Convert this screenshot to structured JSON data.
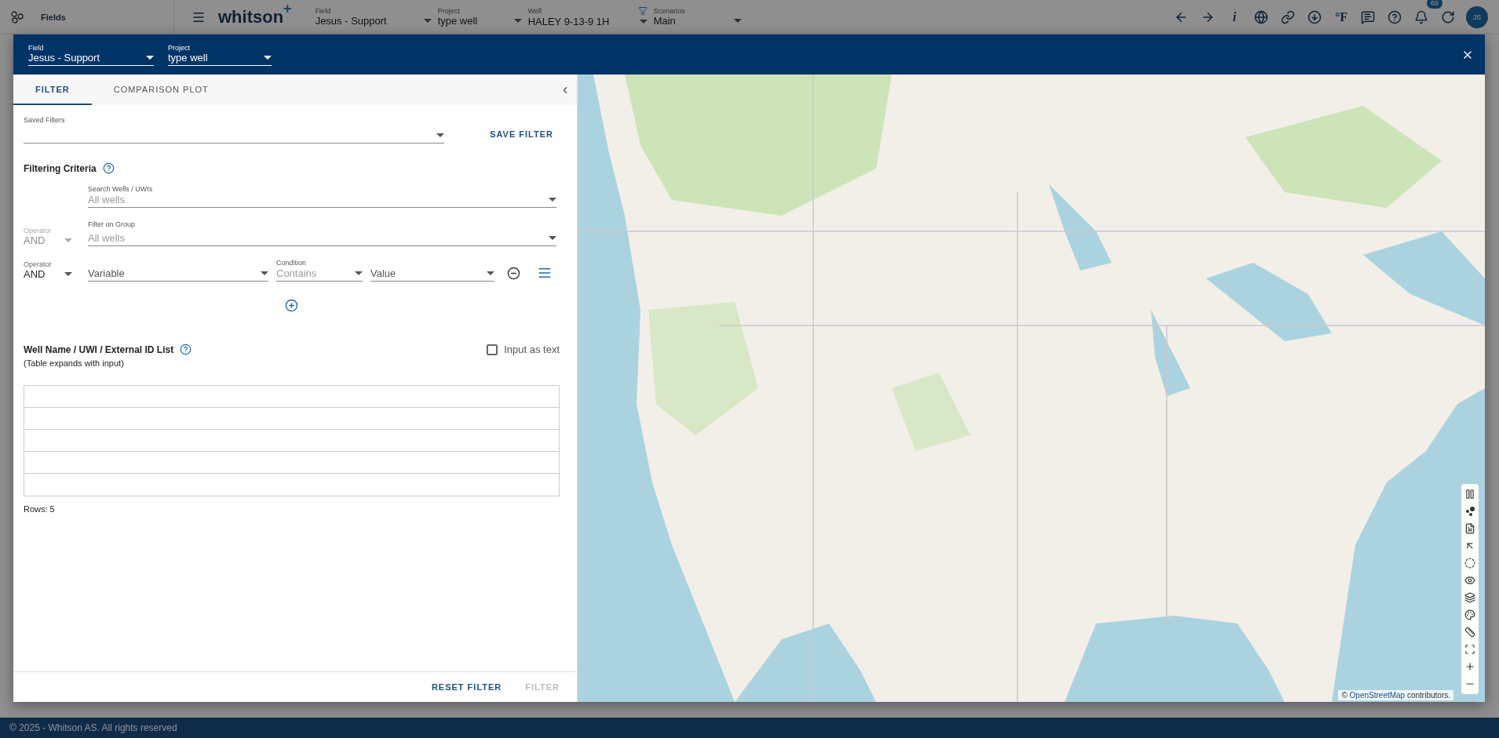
{
  "app_bar": {
    "sidebar_title": "Fields",
    "logo": "whitson",
    "logo_mark": "+",
    "selectors": [
      {
        "label": "Field",
        "value": "Jesus - Support"
      },
      {
        "label": "Project",
        "value": "type well"
      },
      {
        "label": "Well",
        "value": "HALEY 9-13-9 1H"
      },
      {
        "label": "Scenarios",
        "value": "Main"
      }
    ],
    "info_glyph": "i",
    "unit": "°F",
    "notifications": "69",
    "avatar": "JS"
  },
  "dialog": {
    "selectors": [
      {
        "label": "Field",
        "value": "Jesus - Support"
      },
      {
        "label": "Project",
        "value": "type well"
      }
    ],
    "tabs": [
      {
        "label": "FILTER",
        "selected": true
      },
      {
        "label": "COMPARISON PLOT",
        "selected": false
      }
    ],
    "saved_filters": {
      "label": "Saved Filters"
    },
    "save_button": "SAVE FILTER",
    "criteria_title": "Filtering Criteria",
    "search": {
      "label": "Search Wells / UWIs",
      "placeholder": "All wells"
    },
    "group": {
      "label": "Filter on Group",
      "placeholder": "All wells"
    },
    "operators": [
      {
        "label": "Operator",
        "value": "AND",
        "disabled": true
      },
      {
        "label": "Operator",
        "value": "AND",
        "disabled": false
      }
    ],
    "condition_row": {
      "variable": "Variable",
      "condition_label": "Condition",
      "condition": "Contains",
      "condition_disabled": true,
      "value": "Value"
    },
    "list": {
      "title": "Well Name / UWI / External ID List",
      "note": "(Table expands with input)",
      "input_as_text": {
        "label": "Input as text",
        "checked": false
      },
      "rows": [
        {
          "kind": "empty"
        },
        {
          "kind": "empty"
        },
        {
          "kind": "empty"
        },
        {
          "kind": "empty"
        },
        {
          "kind": "empty"
        }
      ],
      "row_count": "Rows: 5"
    },
    "actions": [
      {
        "label": "RESET FILTER",
        "disabled": false
      },
      {
        "label": "FILTER",
        "disabled": true
      }
    ],
    "map": {
      "kind": "picture",
      "attribution": {
        "prefix": "©",
        "link": "OpenStreetMap",
        "suffix": "contributors."
      }
    }
  },
  "footer": "© 2025 - Whitson AS. All rights reserved"
}
